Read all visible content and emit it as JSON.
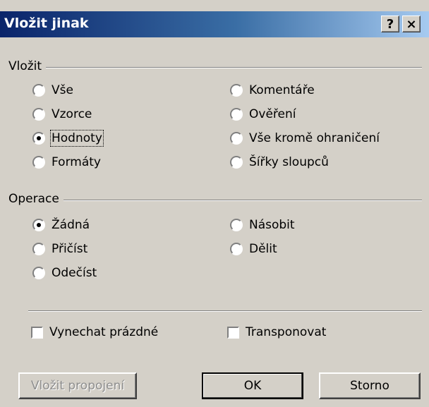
{
  "window": {
    "title": "Vložit jinak",
    "help_label": "?",
    "close_label": "×"
  },
  "paste_group": {
    "label": "Vložit",
    "options": [
      {
        "label": "Vše",
        "selected": false
      },
      {
        "label": "Komentáře",
        "selected": false
      },
      {
        "label": "Vzorce",
        "selected": false
      },
      {
        "label": "Ověření",
        "selected": false
      },
      {
        "label": "Hodnoty",
        "selected": true
      },
      {
        "label": "Vše kromě ohraničení",
        "selected": false
      },
      {
        "label": "Formáty",
        "selected": false
      },
      {
        "label": "Šířky sloupců",
        "selected": false
      }
    ]
  },
  "operation_group": {
    "label": "Operace",
    "options": [
      {
        "label": "Žádná",
        "selected": true
      },
      {
        "label": "Násobit",
        "selected": false
      },
      {
        "label": "Přičíst",
        "selected": false
      },
      {
        "label": "Dělit",
        "selected": false
      },
      {
        "label": "Odečíst",
        "selected": false
      }
    ]
  },
  "checkboxes": {
    "skip_blanks": {
      "label": "Vynechat prázdné",
      "checked": false
    },
    "transpose": {
      "label": "Transponovat",
      "checked": false
    }
  },
  "buttons": {
    "paste_link": "Vložit propojení",
    "ok": "OK",
    "cancel": "Storno"
  }
}
